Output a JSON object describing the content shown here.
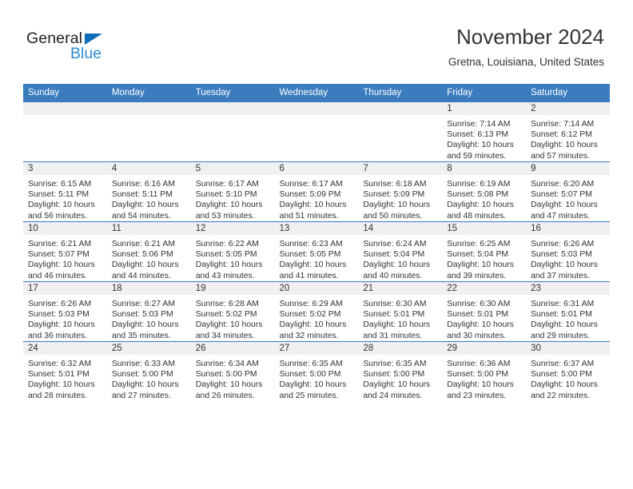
{
  "brand": {
    "name_part1": "General",
    "name_part2": "Blue",
    "primary_color": "#2e8bd6",
    "triangle_color": "#0f6cb6"
  },
  "header": {
    "title": "November 2024",
    "subtitle": "Gretna, Louisiana, United States",
    "header_bg_color": "#3a7cbe"
  },
  "weekday_headers": [
    "Sunday",
    "Monday",
    "Tuesday",
    "Wednesday",
    "Thursday",
    "Friday",
    "Saturday"
  ],
  "weeks": [
    [
      {
        "empty": true
      },
      {
        "empty": true
      },
      {
        "empty": true
      },
      {
        "empty": true
      },
      {
        "empty": true
      },
      {
        "day": "1",
        "sunrise": "Sunrise: 7:14 AM",
        "sunset": "Sunset: 6:13 PM",
        "daylight": "Daylight: 10 hours and 59 minutes."
      },
      {
        "day": "2",
        "sunrise": "Sunrise: 7:14 AM",
        "sunset": "Sunset: 6:12 PM",
        "daylight": "Daylight: 10 hours and 57 minutes."
      }
    ],
    [
      {
        "day": "3",
        "sunrise": "Sunrise: 6:15 AM",
        "sunset": "Sunset: 5:11 PM",
        "daylight": "Daylight: 10 hours and 56 minutes."
      },
      {
        "day": "4",
        "sunrise": "Sunrise: 6:16 AM",
        "sunset": "Sunset: 5:11 PM",
        "daylight": "Daylight: 10 hours and 54 minutes."
      },
      {
        "day": "5",
        "sunrise": "Sunrise: 6:17 AM",
        "sunset": "Sunset: 5:10 PM",
        "daylight": "Daylight: 10 hours and 53 minutes."
      },
      {
        "day": "6",
        "sunrise": "Sunrise: 6:17 AM",
        "sunset": "Sunset: 5:09 PM",
        "daylight": "Daylight: 10 hours and 51 minutes."
      },
      {
        "day": "7",
        "sunrise": "Sunrise: 6:18 AM",
        "sunset": "Sunset: 5:09 PM",
        "daylight": "Daylight: 10 hours and 50 minutes."
      },
      {
        "day": "8",
        "sunrise": "Sunrise: 6:19 AM",
        "sunset": "Sunset: 5:08 PM",
        "daylight": "Daylight: 10 hours and 48 minutes."
      },
      {
        "day": "9",
        "sunrise": "Sunrise: 6:20 AM",
        "sunset": "Sunset: 5:07 PM",
        "daylight": "Daylight: 10 hours and 47 minutes."
      }
    ],
    [
      {
        "day": "10",
        "sunrise": "Sunrise: 6:21 AM",
        "sunset": "Sunset: 5:07 PM",
        "daylight": "Daylight: 10 hours and 46 minutes."
      },
      {
        "day": "11",
        "sunrise": "Sunrise: 6:21 AM",
        "sunset": "Sunset: 5:06 PM",
        "daylight": "Daylight: 10 hours and 44 minutes."
      },
      {
        "day": "12",
        "sunrise": "Sunrise: 6:22 AM",
        "sunset": "Sunset: 5:05 PM",
        "daylight": "Daylight: 10 hours and 43 minutes."
      },
      {
        "day": "13",
        "sunrise": "Sunrise: 6:23 AM",
        "sunset": "Sunset: 5:05 PM",
        "daylight": "Daylight: 10 hours and 41 minutes."
      },
      {
        "day": "14",
        "sunrise": "Sunrise: 6:24 AM",
        "sunset": "Sunset: 5:04 PM",
        "daylight": "Daylight: 10 hours and 40 minutes."
      },
      {
        "day": "15",
        "sunrise": "Sunrise: 6:25 AM",
        "sunset": "Sunset: 5:04 PM",
        "daylight": "Daylight: 10 hours and 39 minutes."
      },
      {
        "day": "16",
        "sunrise": "Sunrise: 6:26 AM",
        "sunset": "Sunset: 5:03 PM",
        "daylight": "Daylight: 10 hours and 37 minutes."
      }
    ],
    [
      {
        "day": "17",
        "sunrise": "Sunrise: 6:26 AM",
        "sunset": "Sunset: 5:03 PM",
        "daylight": "Daylight: 10 hours and 36 minutes."
      },
      {
        "day": "18",
        "sunrise": "Sunrise: 6:27 AM",
        "sunset": "Sunset: 5:03 PM",
        "daylight": "Daylight: 10 hours and 35 minutes."
      },
      {
        "day": "19",
        "sunrise": "Sunrise: 6:28 AM",
        "sunset": "Sunset: 5:02 PM",
        "daylight": "Daylight: 10 hours and 34 minutes."
      },
      {
        "day": "20",
        "sunrise": "Sunrise: 6:29 AM",
        "sunset": "Sunset: 5:02 PM",
        "daylight": "Daylight: 10 hours and 32 minutes."
      },
      {
        "day": "21",
        "sunrise": "Sunrise: 6:30 AM",
        "sunset": "Sunset: 5:01 PM",
        "daylight": "Daylight: 10 hours and 31 minutes."
      },
      {
        "day": "22",
        "sunrise": "Sunrise: 6:30 AM",
        "sunset": "Sunset: 5:01 PM",
        "daylight": "Daylight: 10 hours and 30 minutes."
      },
      {
        "day": "23",
        "sunrise": "Sunrise: 6:31 AM",
        "sunset": "Sunset: 5:01 PM",
        "daylight": "Daylight: 10 hours and 29 minutes."
      }
    ],
    [
      {
        "day": "24",
        "sunrise": "Sunrise: 6:32 AM",
        "sunset": "Sunset: 5:01 PM",
        "daylight": "Daylight: 10 hours and 28 minutes."
      },
      {
        "day": "25",
        "sunrise": "Sunrise: 6:33 AM",
        "sunset": "Sunset: 5:00 PM",
        "daylight": "Daylight: 10 hours and 27 minutes."
      },
      {
        "day": "26",
        "sunrise": "Sunrise: 6:34 AM",
        "sunset": "Sunset: 5:00 PM",
        "daylight": "Daylight: 10 hours and 26 minutes."
      },
      {
        "day": "27",
        "sunrise": "Sunrise: 6:35 AM",
        "sunset": "Sunset: 5:00 PM",
        "daylight": "Daylight: 10 hours and 25 minutes."
      },
      {
        "day": "28",
        "sunrise": "Sunrise: 6:35 AM",
        "sunset": "Sunset: 5:00 PM",
        "daylight": "Daylight: 10 hours and 24 minutes."
      },
      {
        "day": "29",
        "sunrise": "Sunrise: 6:36 AM",
        "sunset": "Sunset: 5:00 PM",
        "daylight": "Daylight: 10 hours and 23 minutes."
      },
      {
        "day": "30",
        "sunrise": "Sunrise: 6:37 AM",
        "sunset": "Sunset: 5:00 PM",
        "daylight": "Daylight: 10 hours and 22 minutes."
      }
    ]
  ]
}
